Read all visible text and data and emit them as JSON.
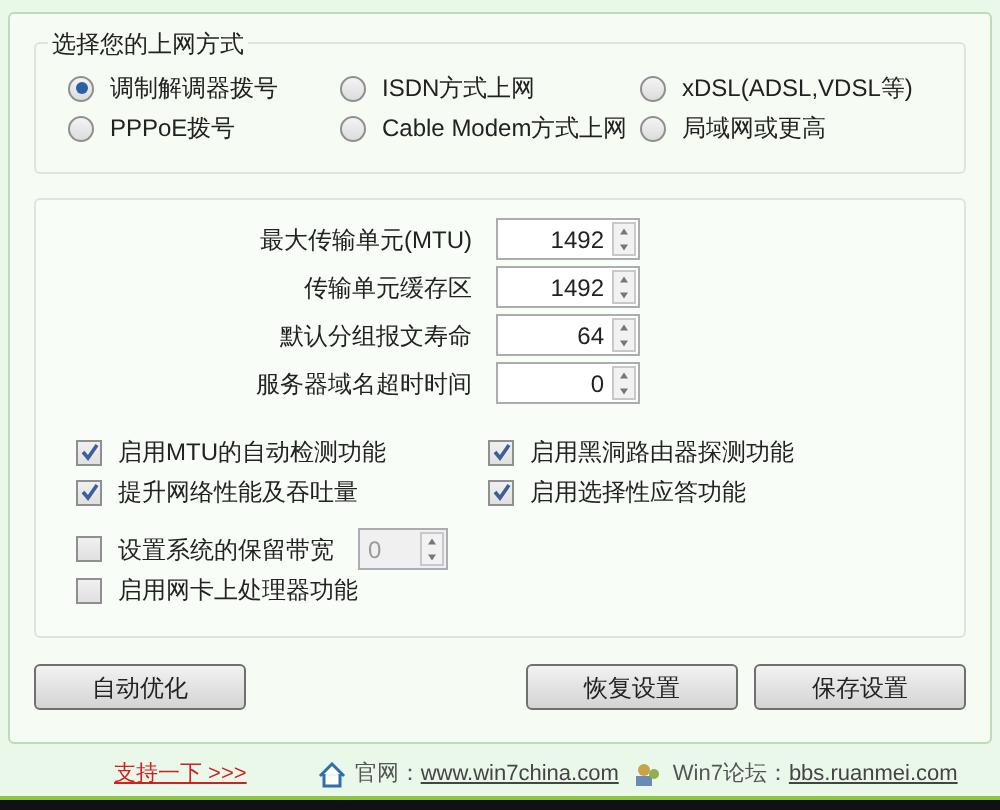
{
  "connection": {
    "title": "选择您的上网方式",
    "options": [
      {
        "label": "调制解调器拨号",
        "selected": true
      },
      {
        "label": "ISDN方式上网",
        "selected": false
      },
      {
        "label": "xDSL(ADSL,VDSL等)",
        "selected": false
      },
      {
        "label": "PPPoE拨号",
        "selected": false
      },
      {
        "label": "Cable Modem方式上网",
        "selected": false
      },
      {
        "label": "局域网或更高",
        "selected": false
      }
    ]
  },
  "fields": [
    {
      "label": "最大传输单元(MTU)",
      "value": "1492"
    },
    {
      "label": "传输单元缓存区",
      "value": "1492"
    },
    {
      "label": "默认分组报文寿命",
      "value": "64"
    },
    {
      "label": "服务器域名超时时间",
      "value": "0"
    }
  ],
  "checkboxes": [
    {
      "label": "启用MTU的自动检测功能",
      "checked": true
    },
    {
      "label": "启用黑洞路由器探测功能",
      "checked": true
    },
    {
      "label": "提升网络性能及吞吐量",
      "checked": true
    },
    {
      "label": "启用选择性应答功能",
      "checked": true
    }
  ],
  "reserved_bandwidth": {
    "label": "设置系统的保留带宽",
    "checked": false,
    "value": "0",
    "disabled": true
  },
  "nic_offload": {
    "label": "启用网卡上处理器功能",
    "checked": false
  },
  "buttons": {
    "left": "自动优化",
    "right": [
      "恢复设置",
      "保存设置"
    ]
  },
  "footer": {
    "support_link": "支持一下 >>>",
    "site_label": "官网：",
    "site_link": "www.win7china.com",
    "forum_label": "Win7论坛：",
    "forum_link": "bbs.ruanmei.com"
  }
}
